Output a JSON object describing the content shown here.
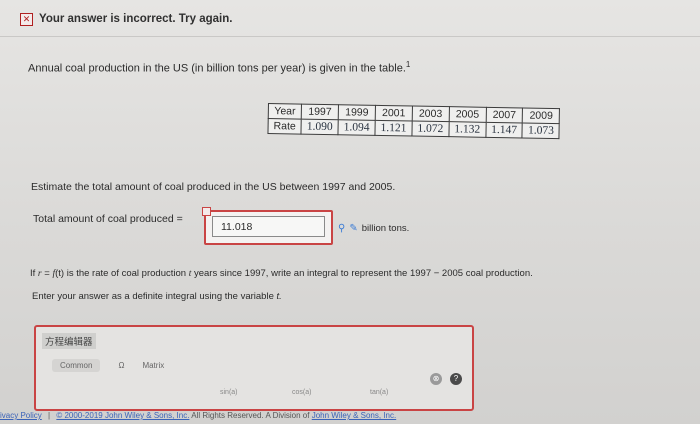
{
  "banner": {
    "icon": "x-icon",
    "text": "Your answer is incorrect.  Try again."
  },
  "question": {
    "intro": "Annual coal production in the US (in billion tons per year) is given in the table.",
    "footnote": "1"
  },
  "table": {
    "rows": [
      {
        "header": "Year",
        "cells": [
          "1997",
          "1999",
          "2001",
          "2003",
          "2005",
          "2007",
          "2009"
        ]
      },
      {
        "header": "Rate",
        "cells": [
          "1.090",
          "1.094",
          "1.121",
          "1.072",
          "1.132",
          "1.147",
          "1.073"
        ]
      }
    ]
  },
  "estimate_prompt": "Estimate the total amount of coal produced in the US between 1997 and 2005.",
  "answer": {
    "label": "Total amount of coal produced =",
    "value": "11.018",
    "unit": "billion tons."
  },
  "integral_prompt": {
    "part1": "If ",
    "var_r": "r",
    "eq": " = ",
    "func": "f",
    "paren": "(t)",
    "part2": " is the rate of coal production ",
    "var_t": "t",
    "part3": " years since 1997, write an integral to represent the 1997 − 2005 coal production."
  },
  "instruction": {
    "text": "Enter your answer as a definite integral using the variable ",
    "var": "t."
  },
  "editor": {
    "title": "方程编辑器",
    "tabs": [
      "Common",
      "Ω",
      "Matrix"
    ],
    "functions": [
      "sin(a)",
      "cos(a)",
      "tan(a)"
    ]
  },
  "footer": {
    "privacy": "ivacy Policy",
    "sep": "|",
    "copyright": "© 2000-2019 John Wiley & Sons, Inc.",
    "rights": "All Rights Reserved. A Division of",
    "company": "John Wiley & Sons, Inc."
  }
}
